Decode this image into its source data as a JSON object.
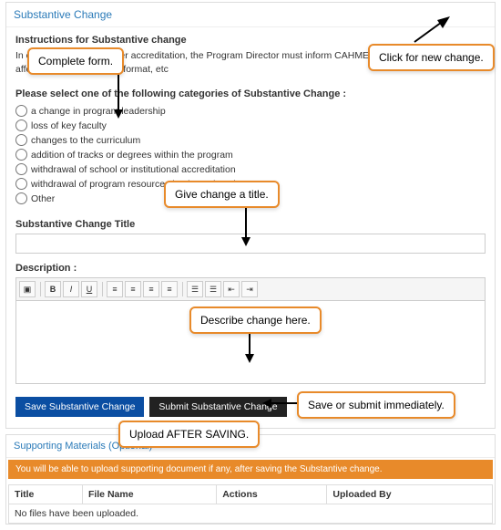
{
  "page": {
    "panel_title": "Substantive Change",
    "instructions_heading": "Instructions for Substantive change",
    "instructions_text": "In order to maintain proper accreditation, the Program Director must inform CAHME of any substantive change affecting the program, its format, etc",
    "categories_label": "Please select one of the following categories of Substantive Change :",
    "categories": [
      "a change in program leadership",
      "loss of key faculty",
      "changes to the curriculum",
      "addition of tracks or degrees within the program",
      "withdrawal of school or institutional accreditation",
      "withdrawal of program resources by the University",
      "Other"
    ],
    "title_label": "Substantive Change Title",
    "description_label": "Description :",
    "save_button": "Save Substantive Change",
    "submit_button": "Submit Substantive Change"
  },
  "support": {
    "header": "Supporting Materials (Optional)",
    "notice": "You will be able to upload supporting document if any, after saving the Substantive change.",
    "columns": {
      "title": "Title",
      "filename": "File Name",
      "actions": "Actions",
      "uploaded_by": "Uploaded By"
    },
    "empty_msg": "No files have been uploaded."
  },
  "callouts": {
    "complete": "Complete form.",
    "new_change": "Click for new change.",
    "give_title": "Give change a title.",
    "describe": "Describe change here.",
    "save_submit": "Save or submit immediately.",
    "upload_after": "Upload AFTER SAVING."
  }
}
